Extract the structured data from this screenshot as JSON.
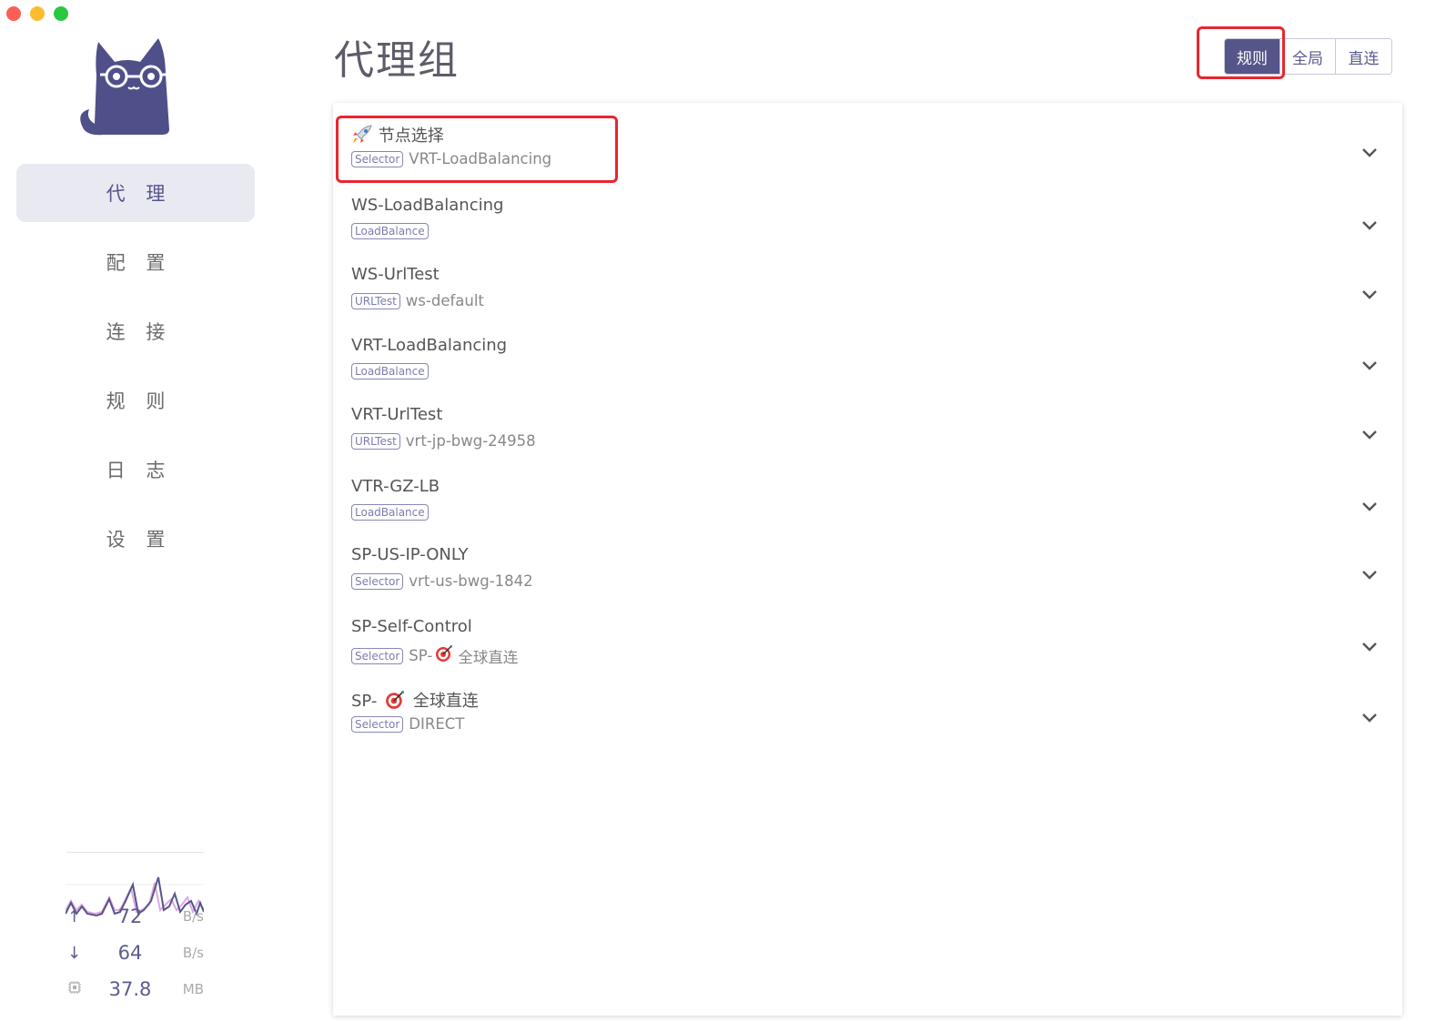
{
  "window": {
    "controls": [
      "close",
      "minimize",
      "maximize"
    ]
  },
  "sidebar": {
    "logo_icon": "cat-with-glasses-logo",
    "nav": [
      {
        "label": "代 理",
        "active": true
      },
      {
        "label": "配 置",
        "active": false
      },
      {
        "label": "连 接",
        "active": false
      },
      {
        "label": "规 则",
        "active": false
      },
      {
        "label": "日 志",
        "active": false
      },
      {
        "label": "设 置",
        "active": false
      }
    ],
    "stats": {
      "upload": {
        "icon": "arrow-up-icon",
        "value": "72",
        "unit": "B/s"
      },
      "download": {
        "icon": "arrow-down-icon",
        "value": "64",
        "unit": "B/s"
      },
      "memory": {
        "icon": "chip-icon",
        "value": "37.8",
        "unit": "MB"
      }
    }
  },
  "header": {
    "title": "代理组",
    "modes": [
      {
        "label": "规则",
        "active": true
      },
      {
        "label": "全局",
        "active": false
      },
      {
        "label": "直连",
        "active": false
      }
    ]
  },
  "groups": [
    {
      "name_prefix_icon": "rocket",
      "name": "节点选择",
      "type": "Selector",
      "now": "VRT-LoadBalancing"
    },
    {
      "name": "WS-LoadBalancing",
      "type": "LoadBalance",
      "now": ""
    },
    {
      "name": "WS-UrlTest",
      "type": "URLTest",
      "now": "ws-default"
    },
    {
      "name": "VRT-LoadBalancing",
      "type": "LoadBalance",
      "now": ""
    },
    {
      "name": "VRT-UrlTest",
      "type": "URLTest",
      "now": "vrt-jp-bwg-24958"
    },
    {
      "name": "VTR-GZ-LB",
      "type": "LoadBalance",
      "now": ""
    },
    {
      "name": "SP-US-IP-ONLY",
      "type": "Selector",
      "now": "vrt-us-bwg-1842"
    },
    {
      "name": "SP-Self-Control",
      "type": "Selector",
      "now_prefix": "SP-",
      "now_icon": "target",
      "now": "全球直连"
    },
    {
      "name_prefix": "SP-",
      "name_icon": "target",
      "name": "全球直连",
      "type": "Selector",
      "now": "DIRECT"
    }
  ],
  "colors": {
    "accent": "#55558a",
    "highlight": "#e8262e"
  }
}
